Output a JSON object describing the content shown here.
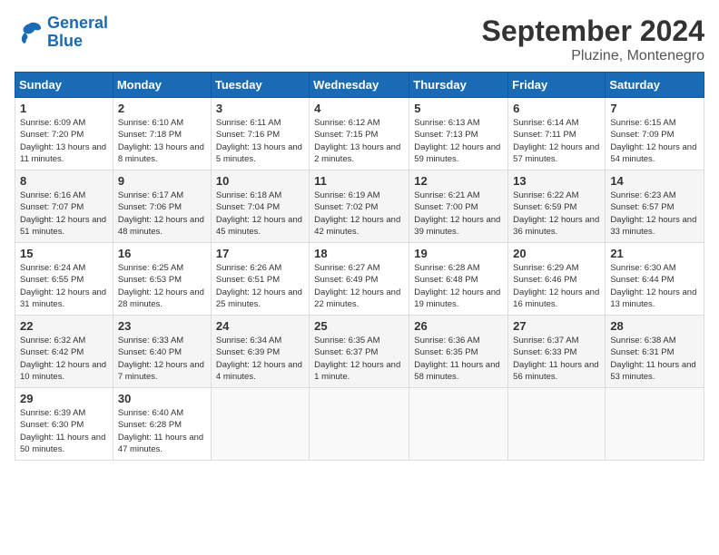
{
  "header": {
    "logo_line1": "General",
    "logo_line2": "Blue",
    "month": "September 2024",
    "location": "Pluzine, Montenegro"
  },
  "weekdays": [
    "Sunday",
    "Monday",
    "Tuesday",
    "Wednesday",
    "Thursday",
    "Friday",
    "Saturday"
  ],
  "weeks": [
    [
      {
        "day": "1",
        "sunrise": "6:09 AM",
        "sunset": "7:20 PM",
        "daylight": "13 hours and 11 minutes."
      },
      {
        "day": "2",
        "sunrise": "6:10 AM",
        "sunset": "7:18 PM",
        "daylight": "13 hours and 8 minutes."
      },
      {
        "day": "3",
        "sunrise": "6:11 AM",
        "sunset": "7:16 PM",
        "daylight": "13 hours and 5 minutes."
      },
      {
        "day": "4",
        "sunrise": "6:12 AM",
        "sunset": "7:15 PM",
        "daylight": "13 hours and 2 minutes."
      },
      {
        "day": "5",
        "sunrise": "6:13 AM",
        "sunset": "7:13 PM",
        "daylight": "12 hours and 59 minutes."
      },
      {
        "day": "6",
        "sunrise": "6:14 AM",
        "sunset": "7:11 PM",
        "daylight": "12 hours and 57 minutes."
      },
      {
        "day": "7",
        "sunrise": "6:15 AM",
        "sunset": "7:09 PM",
        "daylight": "12 hours and 54 minutes."
      }
    ],
    [
      {
        "day": "8",
        "sunrise": "6:16 AM",
        "sunset": "7:07 PM",
        "daylight": "12 hours and 51 minutes."
      },
      {
        "day": "9",
        "sunrise": "6:17 AM",
        "sunset": "7:06 PM",
        "daylight": "12 hours and 48 minutes."
      },
      {
        "day": "10",
        "sunrise": "6:18 AM",
        "sunset": "7:04 PM",
        "daylight": "12 hours and 45 minutes."
      },
      {
        "day": "11",
        "sunrise": "6:19 AM",
        "sunset": "7:02 PM",
        "daylight": "12 hours and 42 minutes."
      },
      {
        "day": "12",
        "sunrise": "6:21 AM",
        "sunset": "7:00 PM",
        "daylight": "12 hours and 39 minutes."
      },
      {
        "day": "13",
        "sunrise": "6:22 AM",
        "sunset": "6:59 PM",
        "daylight": "12 hours and 36 minutes."
      },
      {
        "day": "14",
        "sunrise": "6:23 AM",
        "sunset": "6:57 PM",
        "daylight": "12 hours and 33 minutes."
      }
    ],
    [
      {
        "day": "15",
        "sunrise": "6:24 AM",
        "sunset": "6:55 PM",
        "daylight": "12 hours and 31 minutes."
      },
      {
        "day": "16",
        "sunrise": "6:25 AM",
        "sunset": "6:53 PM",
        "daylight": "12 hours and 28 minutes."
      },
      {
        "day": "17",
        "sunrise": "6:26 AM",
        "sunset": "6:51 PM",
        "daylight": "12 hours and 25 minutes."
      },
      {
        "day": "18",
        "sunrise": "6:27 AM",
        "sunset": "6:49 PM",
        "daylight": "12 hours and 22 minutes."
      },
      {
        "day": "19",
        "sunrise": "6:28 AM",
        "sunset": "6:48 PM",
        "daylight": "12 hours and 19 minutes."
      },
      {
        "day": "20",
        "sunrise": "6:29 AM",
        "sunset": "6:46 PM",
        "daylight": "12 hours and 16 minutes."
      },
      {
        "day": "21",
        "sunrise": "6:30 AM",
        "sunset": "6:44 PM",
        "daylight": "12 hours and 13 minutes."
      }
    ],
    [
      {
        "day": "22",
        "sunrise": "6:32 AM",
        "sunset": "6:42 PM",
        "daylight": "12 hours and 10 minutes."
      },
      {
        "day": "23",
        "sunrise": "6:33 AM",
        "sunset": "6:40 PM",
        "daylight": "12 hours and 7 minutes."
      },
      {
        "day": "24",
        "sunrise": "6:34 AM",
        "sunset": "6:39 PM",
        "daylight": "12 hours and 4 minutes."
      },
      {
        "day": "25",
        "sunrise": "6:35 AM",
        "sunset": "6:37 PM",
        "daylight": "12 hours and 1 minute."
      },
      {
        "day": "26",
        "sunrise": "6:36 AM",
        "sunset": "6:35 PM",
        "daylight": "11 hours and 58 minutes."
      },
      {
        "day": "27",
        "sunrise": "6:37 AM",
        "sunset": "6:33 PM",
        "daylight": "11 hours and 56 minutes."
      },
      {
        "day": "28",
        "sunrise": "6:38 AM",
        "sunset": "6:31 PM",
        "daylight": "11 hours and 53 minutes."
      }
    ],
    [
      {
        "day": "29",
        "sunrise": "6:39 AM",
        "sunset": "6:30 PM",
        "daylight": "11 hours and 50 minutes."
      },
      {
        "day": "30",
        "sunrise": "6:40 AM",
        "sunset": "6:28 PM",
        "daylight": "11 hours and 47 minutes."
      },
      null,
      null,
      null,
      null,
      null
    ]
  ]
}
